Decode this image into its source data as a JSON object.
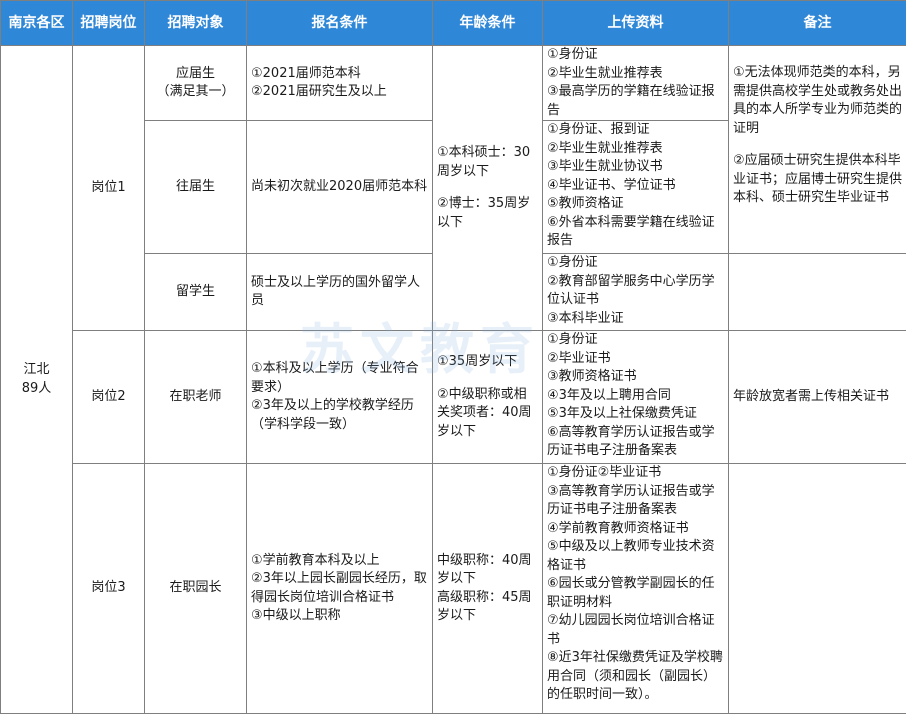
{
  "headers": [
    "南京各区",
    "招聘岗位",
    "招聘对象",
    "报名条件",
    "年龄条件",
    "上传资料",
    "备注"
  ],
  "district": [
    "江北",
    "89人"
  ],
  "posts": {
    "p1": "岗位1",
    "p2": "岗位2",
    "p3": "岗位3"
  },
  "targets": {
    "fresh": [
      "应届生",
      "（满足其一）"
    ],
    "previous": "往届生",
    "overseas": "留学生",
    "teacher": "在职老师",
    "principal": "在职园长"
  },
  "conditions": {
    "fresh": [
      "①2021届师范本科",
      "②2021届研究生及以上"
    ],
    "previous": "尚未初次就业2020届师范本科",
    "overseas": "硕士及以上学历的国外留学人员",
    "teacher": [
      "①本科及以上学历（专业符合要求）",
      "②3年及以上的学校教学经历（学科学段一致）"
    ],
    "principal": [
      "①学前教育本科及以上",
      "②3年以上园长副园长经历，取得园长岗位培训合格证书",
      "③中级以上职称"
    ]
  },
  "ages": {
    "p1": [
      "①本科硕士：30周岁以下",
      "②博士：35周岁以下"
    ],
    "p2": [
      "①35周岁以下",
      "②中级职称或相关奖项者：40周岁以下"
    ],
    "p3": [
      "中级职称：40周岁以下",
      "高级职称：45周岁以下"
    ]
  },
  "uploads": {
    "fresh": [
      "①身份证",
      "②毕业生就业推荐表",
      "③最高学历的学籍在线验证报告"
    ],
    "previous": [
      "①身份证、报到证",
      "②毕业生就业推荐表",
      "③毕业生就业协议书",
      "④毕业证书、学位证书",
      "⑤教师资格证",
      "⑥外省本科需要学籍在线验证报告"
    ],
    "overseas": [
      "①身份证",
      "②教育部留学服务中心学历学位认证书",
      "③本科毕业证"
    ],
    "teacher": [
      "①身份证",
      "②毕业证书",
      "③教师资格证书",
      "④3年及以上聘用合同",
      "⑤3年及以上社保缴费凭证",
      "⑥高等教育学历认证报告或学历证书电子注册备案表"
    ],
    "principal": [
      "①身份证②毕业证书",
      "③高等教育学历认证报告或学历证书电子注册备案表",
      "④学前教育教师资格证书",
      "⑤中级及以上教师专业技术资格证书",
      "⑥园长或分管教学副园长的任职证明材料",
      "⑦幼儿园园长岗位培训合格证书",
      "⑧近3年社保缴费凭证及学校聘用合同（须和园长（副园长）的任职时间一致）。"
    ]
  },
  "notes": {
    "p1": [
      "①无法体现师范类的本科，另需提供高校学生处或教务处出具的本人所学专业为师范类的证明",
      "②应届硕士研究生提供本科毕业证书；应届博士研究生提供本科、硕士研究生毕业证书"
    ],
    "p2": "年龄放宽者需上传相关证书"
  },
  "watermark": "苏文教育"
}
